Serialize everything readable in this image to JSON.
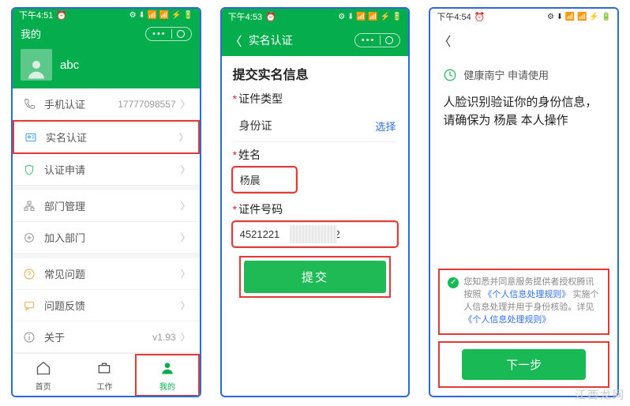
{
  "watermark": "江西龙网",
  "screen1": {
    "status": {
      "time": "下午4:51",
      "alarm": "⏰",
      "right": "⚙ ⬇ 📶 📶 ⚡ 🔋"
    },
    "header": {
      "title": "我的",
      "pill_dots": "•••",
      "username": "abc"
    },
    "items": [
      {
        "icon": "phone",
        "label": "手机认证",
        "value": "17777098557"
      },
      {
        "icon": "idcard",
        "label": "实名认证",
        "value": ""
      },
      {
        "icon": "shield",
        "label": "认证申请",
        "value": ""
      },
      {
        "icon": "org",
        "label": "部门管理",
        "value": ""
      },
      {
        "icon": "join",
        "label": "加入部门",
        "value": ""
      },
      {
        "icon": "help",
        "label": "常见问题",
        "value": ""
      },
      {
        "icon": "feedback",
        "label": "问题反馈",
        "value": ""
      },
      {
        "icon": "about",
        "label": "关于",
        "value": "v1.93"
      }
    ],
    "tabs": [
      {
        "label": "首页"
      },
      {
        "label": "工作"
      },
      {
        "label": "我的"
      }
    ]
  },
  "screen2": {
    "status": {
      "time": "下午4:53",
      "alarm": "⏰",
      "right": "⚙ ⬇ 📶 📶 ⚡ 🔋"
    },
    "appbar_title": "实名认证",
    "form_title": "提交实名信息",
    "id_type_label": "证件类型",
    "id_type_value": "身份证",
    "choose": "选择",
    "name_label": "姓名",
    "name_value": "杨晨",
    "idnum_label": "证件号码",
    "idnum_prefix": "4521221",
    "idnum_suffix": "12",
    "submit": "提交"
  },
  "screen3": {
    "status": {
      "time": "下午4:54",
      "alarm": "⏰",
      "right": "⚙ ⬇ 📶 📶 ⚡ 🔋"
    },
    "brand": "健康南宁 申请使用",
    "face_text": "人脸识别验证你的身份信息，请确保为 杨晨 本人操作",
    "consent_a": "您知悉并同意服务提供者授权腾讯按照",
    "consent_link1": "《个人信息处理规则》",
    "consent_b": "实施个人信息处理并用于身份核验。详见",
    "consent_link2": "《个人信息处理规则》",
    "next": "下一步"
  }
}
